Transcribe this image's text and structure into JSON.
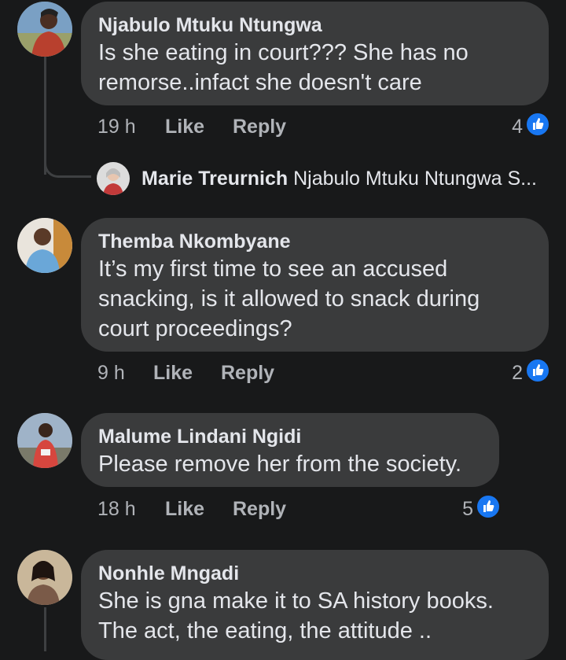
{
  "comments": [
    {
      "name": "Njabulo Mtuku Ntungwa",
      "text": "Is she eating in court??? She has no\nremorse..infact she doesn't care",
      "time": "19 h",
      "like_label": "Like",
      "reply_label": "Reply",
      "reactions": "4"
    },
    {
      "name": "Themba Nkombyane",
      "text": "It’s my first time to see an accused\nsnacking, is it allowed to snack during\ncourt proceedings?",
      "time": "9 h",
      "like_label": "Like",
      "reply_label": "Reply",
      "reactions": "2"
    },
    {
      "name": "Malume Lindani Ngidi",
      "text": "Please remove her from the society.",
      "time": "18 h",
      "like_label": "Like",
      "reply_label": "Reply",
      "reactions": "5"
    },
    {
      "name": "Nonhle Mngadi",
      "text": "She is gna make it to SA history books.\nThe act, the eating, the attitude ..",
      "time": "",
      "like_label": "",
      "reply_label": "",
      "reactions": ""
    }
  ],
  "reply_preview": {
    "name": "Marie Treurnich",
    "text": "Njabulo Mtuku Ntungwa S..."
  },
  "colors": {
    "background": "#18191a",
    "bubble": "#3a3b3c",
    "text": "#e4e6eb",
    "secondary": "#b0b3b8",
    "like_blue": "#1877f2"
  },
  "icons": [
    "avatar",
    "like-reaction-icon",
    "thread-connector"
  ]
}
